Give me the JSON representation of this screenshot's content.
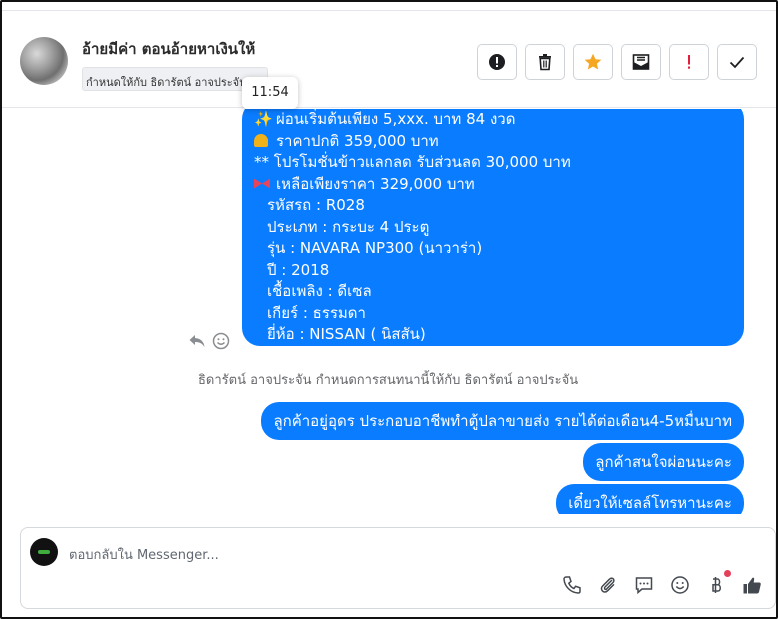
{
  "header": {
    "title": "อ้ายมีค่า ตอนอ้ายหาเงินให้",
    "assigned_to": "กำหนดให้กับ ธิดารัตน์ อาจประจัน",
    "tooltip_time": "11:54"
  },
  "actions": [
    {
      "icon": "alert-circle-icon",
      "color": "#1c1e21"
    },
    {
      "icon": "trash-icon",
      "color": "#1c1e21"
    },
    {
      "icon": "star-icon",
      "color": "#f5a623"
    },
    {
      "icon": "mail-archive-icon",
      "color": "#1c1e21"
    },
    {
      "icon": "exclamation-icon",
      "color": "#e41e3f"
    },
    {
      "icon": "check-icon",
      "color": "#1c1e21"
    }
  ],
  "conversation": {
    "big_message": {
      "line1": "ผ่อนเริ่มต้นเพียง 5,xxx. บาท 84 งวด",
      "line2": "ราคาปกติ 359,000 บาท",
      "line3": "** โปรโมชั่นข้าวแลกลด รับส่วนลด 30,000 บาท",
      "line4": "เหลือเพียงราคา 329,000 บาท",
      "line5": "รหัสรถ : R028",
      "line6": "ประเภท : กระบะ 4 ประตู",
      "line7": "รุ่น : NAVARA NP300 (นาวาร่า)",
      "line8": "ปี : 2018",
      "line9": "เชื้อเพลิง : ดีเซล",
      "line10": "เกียร์ : ธรรมดา",
      "line11": "ยี่ห้อ : NISSAN ( นิสสัน)",
      "sparkle_emoji": "✨"
    },
    "system_note": "ธิดารัตน์ อาจประจัน กำหนดการสนทนานี้ให้กับ ธิดารัตน์ อาจประจัน",
    "messages": [
      "ลูกค้าอยู่อุดร ประกอบอาชีพทำตู้ปลาขายส่ง รายได้ต่อเดือน4-5หมื่นบาท",
      "ลูกค้าสนใจผ่อนนะคะ",
      "เดี๋ยวให้เซลล์โทรหานะคะ"
    ],
    "bubble_color": "#0a7cff"
  },
  "composer": {
    "placeholder": "ตอบกลับใน Messenger..."
  }
}
